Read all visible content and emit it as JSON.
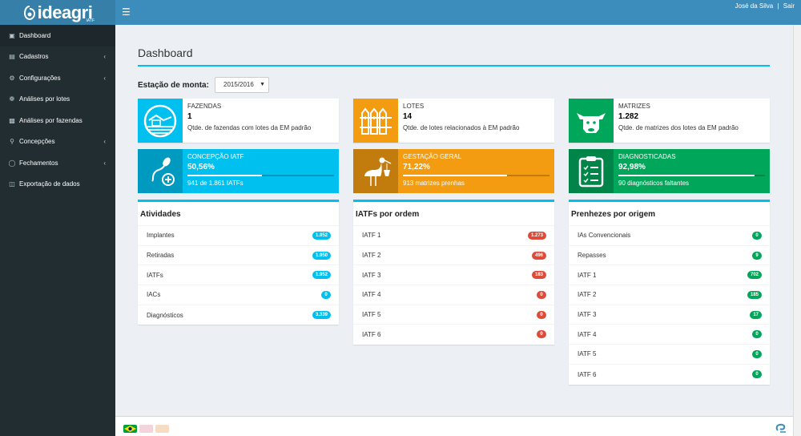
{
  "app": {
    "logo_text": "ideagri",
    "logo_sub": "IATF",
    "menu_icon": "hamburger-icon"
  },
  "user": {
    "name": "José da Silva",
    "separator": "|",
    "logout": "Sair"
  },
  "sidebar": {
    "items": [
      {
        "label": "Dashboard",
        "icon": "dashboard-icon"
      },
      {
        "label": "Cadastros",
        "icon": "file-icon"
      },
      {
        "label": "Configurações",
        "icon": "cogs-icon"
      },
      {
        "label": "Análises por lotes",
        "icon": "paw-icon"
      },
      {
        "label": "Análises por fazendas",
        "icon": "map-icon"
      },
      {
        "label": "Concepções",
        "icon": "concepcao-icon"
      },
      {
        "label": "Fechamentos",
        "icon": "bicycle-icon"
      },
      {
        "label": "Exportação de dados",
        "icon": "export-icon"
      }
    ]
  },
  "page": {
    "title": "Dashboard",
    "season_label": "Estação de monta:",
    "season_value": "2015/2016"
  },
  "info_boxes": [
    {
      "label": "FAZENDAS",
      "value": "1",
      "desc": "Qtde. de fazendas com lotes da EM padrão",
      "color": "#00c0ef",
      "icon": "farm-icon"
    },
    {
      "label": "LOTES",
      "value": "14",
      "desc": "Qtde. de lotes relacionados à EM padrão",
      "color": "#f39c12",
      "icon": "fence-icon"
    },
    {
      "label": "MATRIZES",
      "value": "1.282",
      "desc": "Qtde. de matrizes dos lotes da EM padrão",
      "color": "#00a65a",
      "icon": "cow-icon"
    }
  ],
  "stat_boxes": [
    {
      "label": "CONCEPÇÃO IATF",
      "value": "50,56%",
      "progress": 0.5056,
      "desc": "941 de 1.861 IATFs",
      "color": "#00c0ef",
      "icon": "sperm-icon"
    },
    {
      "label": "GESTAÇÃO GERAL",
      "value": "71,22%",
      "progress": 0.7122,
      "desc": "913 matrizes prenhas",
      "color": "#f39c12",
      "icon": "stork-icon"
    },
    {
      "label": "DIAGNOSTICADAS",
      "value": "92,98%",
      "progress": 0.9298,
      "desc": "90 diagnósticos faltantes",
      "color": "#00a65a",
      "icon": "clipboard-icon"
    }
  ],
  "panels": [
    {
      "title": "Atividades",
      "badge_color": "#00c0ef",
      "rows": [
        {
          "label": "Implantes",
          "value": "1.952"
        },
        {
          "label": "Retiradas",
          "value": "1.950"
        },
        {
          "label": "IATFs",
          "value": "1.952"
        },
        {
          "label": "IACs",
          "value": "0"
        },
        {
          "label": "Diagnósticos",
          "value": "3.339"
        }
      ]
    },
    {
      "title": "IATFs por ordem",
      "badge_color": "#dd4b39",
      "rows": [
        {
          "label": "IATF 1",
          "value": "1.273"
        },
        {
          "label": "IATF 2",
          "value": "496"
        },
        {
          "label": "IATF 3",
          "value": "183"
        },
        {
          "label": "IATF 4",
          "value": "0"
        },
        {
          "label": "IATF 5",
          "value": "0"
        },
        {
          "label": "IATF 6",
          "value": "0"
        }
      ]
    },
    {
      "title": "Prenhezes por origem",
      "badge_color": "#00a65a",
      "rows": [
        {
          "label": "IAs Convencionais",
          "value": "0"
        },
        {
          "label": "Repasses",
          "value": "9"
        },
        {
          "label": "IATF 1",
          "value": "702"
        },
        {
          "label": "IATF 2",
          "value": "185"
        },
        {
          "label": "IATF 3",
          "value": "17"
        },
        {
          "label": "IATF 4",
          "value": "0"
        },
        {
          "label": "IATF 5",
          "value": "0"
        },
        {
          "label": "IATF 6",
          "value": "0"
        }
      ]
    }
  ],
  "footer": {
    "flags": [
      "brazil-flag-icon",
      "usa-flag-icon",
      "spain-flag-icon"
    ]
  }
}
